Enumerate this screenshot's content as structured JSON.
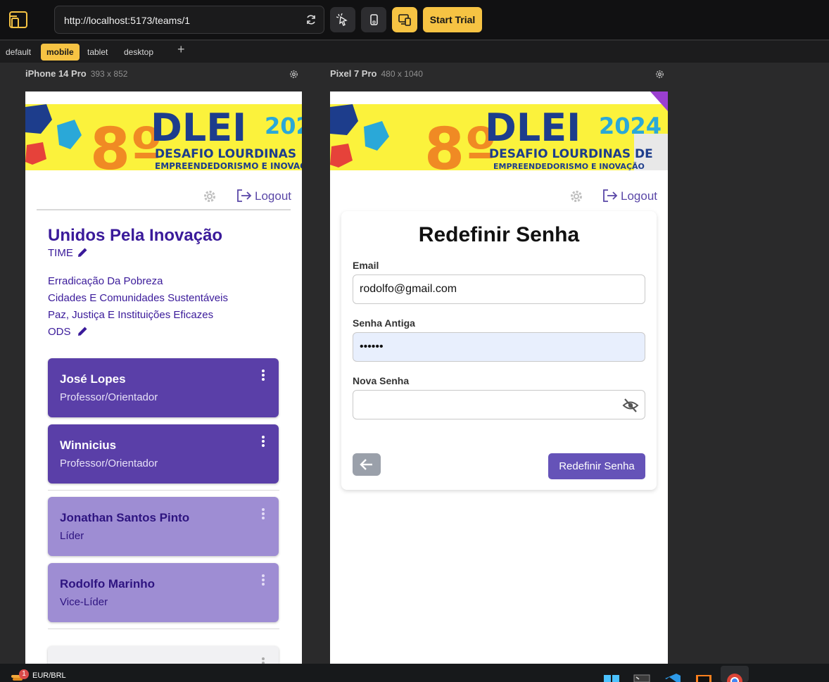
{
  "toolbar": {
    "url": "http://localhost:5173/teams/1",
    "start_trial": "Start Trial"
  },
  "device_tabs": [
    "default",
    "mobile",
    "tablet",
    "desktop"
  ],
  "devices": [
    {
      "name": "iPhone 14 Pro",
      "dims": "393 x 852"
    },
    {
      "name": "Pixel 7 Pro",
      "dims": "480 x 1040"
    }
  ],
  "banner": {
    "number": "8º",
    "brand": "DLEI",
    "year_short": "202",
    "year": "2024",
    "line1_short": "DESAFIO LOURDINAS",
    "line1": "DESAFIO LOURDINAS DE",
    "line2_short": "EMPREENDEDORISMO E INOVAÇ",
    "line2": "EMPREENDEDORISMO E INOVAÇÃO"
  },
  "nav": {
    "logout": "Logout"
  },
  "team": {
    "name": "Unidos Pela Inovação",
    "label": "TIME",
    "ods": [
      "Erradicação Da Pobreza",
      "Cidades E Comunidades Sustentáveis",
      "Paz, Justiça E Instituições Eficazes"
    ],
    "ods_label": "ODS"
  },
  "members": [
    {
      "name": "José Lopes",
      "role": "Professor/Orientador"
    },
    {
      "name": "Winnicius",
      "role": "Professor/Orientador"
    },
    {
      "name": "Jonathan Santos Pinto",
      "role": "Líder"
    },
    {
      "name": "Rodolfo Marinho",
      "role": "Vice-Líder"
    }
  ],
  "reset": {
    "title": "Redefinir Senha",
    "email_label": "Email",
    "email_value": "rodolfo@gmail.com",
    "old_label": "Senha Antiga",
    "old_value": "••••••",
    "new_label": "Nova Senha",
    "new_value": "",
    "submit": "Redefinir Senha"
  },
  "taskbar": {
    "ticker": "EUR/BRL",
    "badge": "1"
  },
  "colors": {
    "accent": "#f6c343",
    "purple_dark": "#5a3fa8",
    "purple_light": "#9e8dd3",
    "button": "#6553b8"
  }
}
